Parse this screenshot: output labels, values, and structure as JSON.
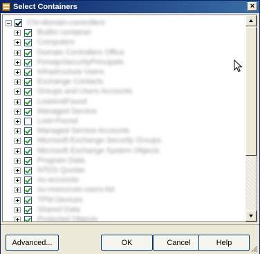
{
  "window": {
    "title": "Select Containers",
    "close_label": "×"
  },
  "tree": {
    "root": {
      "label": "CN=domain-controllers",
      "checked": true,
      "expanded": true
    },
    "items": [
      {
        "label": "Builtin container",
        "checked": true
      },
      {
        "label": "Computers",
        "checked": true
      },
      {
        "label": "Domain Controllers Office",
        "checked": true
      },
      {
        "label": "ForeignSecurityPrincipals",
        "checked": true
      },
      {
        "label": "Infrastructure Users",
        "checked": true
      },
      {
        "label": "Exchange Contacts",
        "checked": true
      },
      {
        "label": "Groups and Users Accounts",
        "checked": true
      },
      {
        "label": "LostAndFound",
        "checked": true
      },
      {
        "label": "Managed Service",
        "checked": true
      },
      {
        "label": "Lost+Found",
        "checked": false
      },
      {
        "label": "Managed Service Accounts",
        "checked": true
      },
      {
        "label": "Microsoft Exchange Security Groups",
        "checked": true
      },
      {
        "label": "Microsoft Exchange System Objects",
        "checked": true
      },
      {
        "label": "Program Data",
        "checked": true
      },
      {
        "label": "NTDS Quotas",
        "checked": true
      },
      {
        "label": "ou-accounts",
        "checked": true
      },
      {
        "label": "ou-resources-users-list",
        "checked": true
      },
      {
        "label": "TPM Devices",
        "checked": true
      },
      {
        "label": "Shared Data",
        "checked": true
      },
      {
        "label": "Protected Objects",
        "checked": true
      }
    ]
  },
  "buttons": {
    "advanced": "Advanced...",
    "ok": "OK",
    "cancel": "Cancel",
    "help": "Help"
  },
  "icons": {
    "app": "app-icon",
    "close": "close-icon",
    "scroll_up": "scroll-up-icon",
    "scroll_down": "scroll-down-icon",
    "cursor": "mouse-cursor-icon",
    "resize": "resize-grip-icon"
  }
}
